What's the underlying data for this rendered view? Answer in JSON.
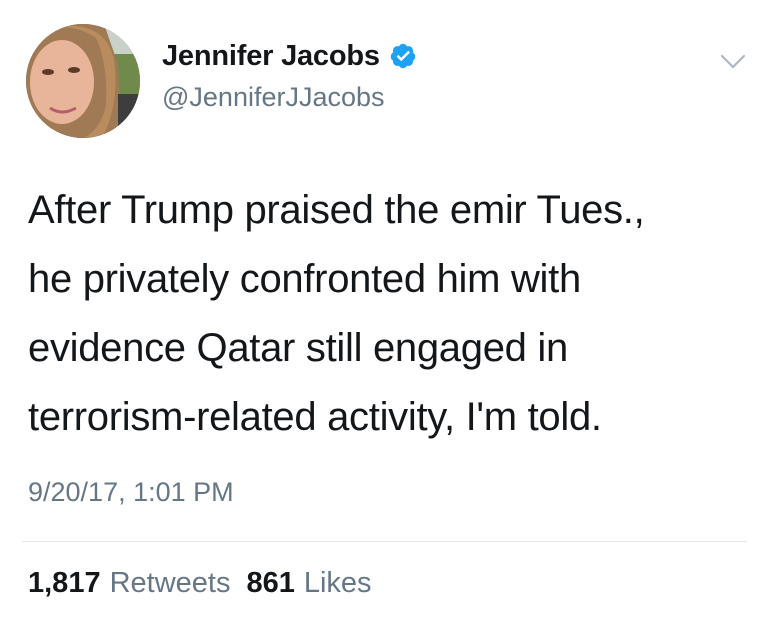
{
  "author": {
    "display_name": "Jennifer Jacobs",
    "handle": "@JenniferJJacobs",
    "verified": true,
    "avatar_icon": "profile-photo"
  },
  "tweet": {
    "lines": [
      "After Trump praised the emir Tues.,",
      "he privately confronted him with",
      "evidence Qatar still engaged in",
      "terrorism-related activity, I'm told."
    ],
    "timestamp": "9/20/17, 1:01 PM"
  },
  "stats": {
    "retweets_count": "1,817",
    "retweets_label": "Retweets",
    "likes_count": "861",
    "likes_label": "Likes"
  },
  "colors": {
    "verified_blue": "#1da1f2",
    "secondary_text": "#657786",
    "primary_text": "#14171a",
    "divider": "#e1e8ed"
  },
  "icons": {
    "verified": "verified-badge-icon",
    "more": "chevron-down-icon"
  }
}
